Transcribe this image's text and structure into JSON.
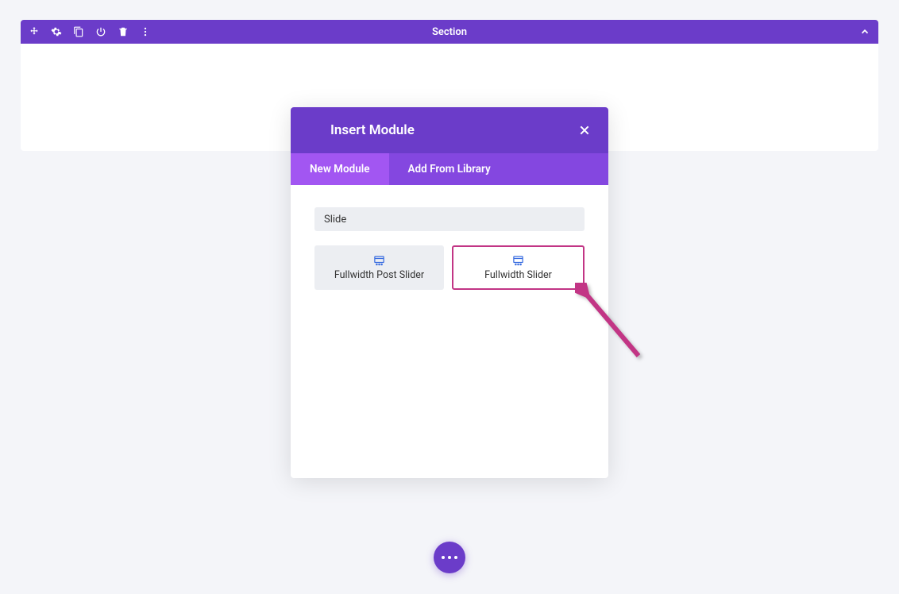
{
  "section": {
    "title": "Section"
  },
  "modal": {
    "title": "Insert Module",
    "tabs": {
      "new": "New Module",
      "library": "Add From Library"
    },
    "search_value": "Slide",
    "modules": [
      {
        "label": "Fullwidth Post Slider"
      },
      {
        "label": "Fullwidth Slider"
      }
    ]
  }
}
